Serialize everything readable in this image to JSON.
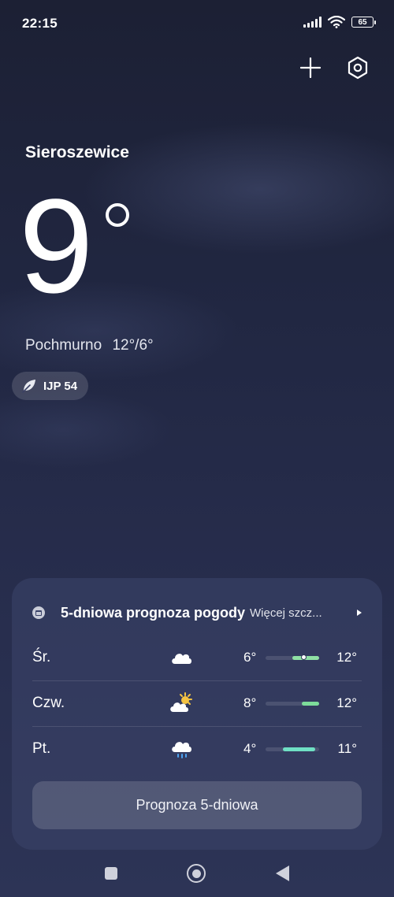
{
  "status_bar": {
    "time": "22:15",
    "battery_level": "65",
    "icons": [
      "signal-icon",
      "wifi-icon",
      "battery-icon"
    ]
  },
  "header": {
    "add_icon": "plus-icon",
    "settings_icon": "settings-hexagon-icon"
  },
  "location": {
    "city": "Sieroszewice",
    "temperature": "9",
    "condition": "Pochmurno",
    "range": "12°/6°"
  },
  "aqi": {
    "icon": "leaf-icon",
    "label": "IJP 54"
  },
  "forecast_card": {
    "title": "5-dniowa prognoza pogody",
    "more_label": "Więcej szcz...",
    "days": [
      {
        "day": "Śr.",
        "icon": "cloud-icon",
        "low": "6°",
        "high": "12°",
        "bar_start": 0.5,
        "bar_end": 1.0,
        "current_marker": 0.72,
        "bar_color": "#8fe0a4"
      },
      {
        "day": "Czw.",
        "icon": "sun-cloud-icon",
        "low": "8°",
        "high": "12°",
        "bar_start": 0.68,
        "bar_end": 1.0,
        "bar_color": "#7ddc9a"
      },
      {
        "day": "Pt.",
        "icon": "rain-cloud-icon",
        "low": "4°",
        "high": "11°",
        "bar_start": 0.32,
        "bar_end": 0.92,
        "bar_color": "#6fe0c4"
      }
    ],
    "button_label": "Prognoza 5-dniowa"
  },
  "navigation": {
    "recents_icon": "square-icon",
    "home_icon": "home-circle-icon",
    "back_icon": "back-triangle-icon"
  }
}
